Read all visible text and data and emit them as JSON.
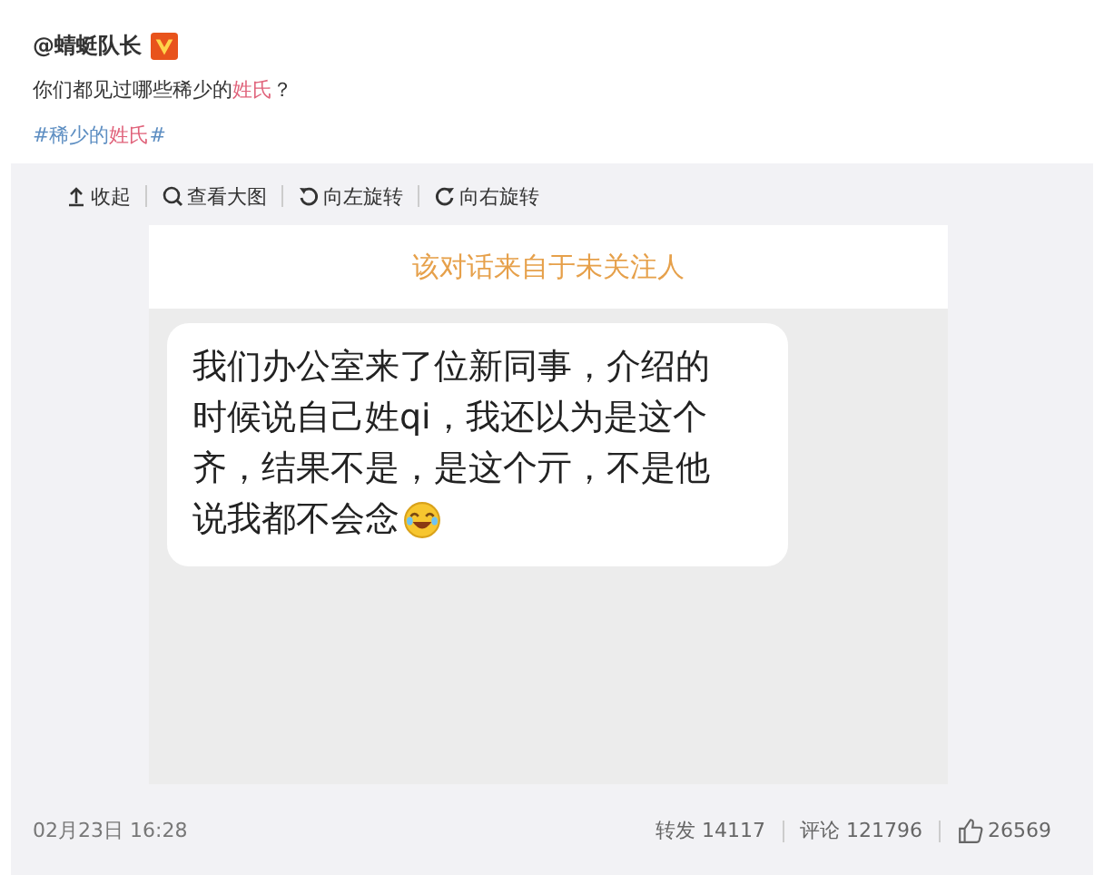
{
  "post": {
    "author": "@蜻蜓队长",
    "verified": true,
    "text_parts": [
      {
        "text": "你们都见过哪些稀少的",
        "highlight": false
      },
      {
        "text": "姓氏",
        "highlight": true
      },
      {
        "text": "？",
        "highlight": false
      }
    ],
    "hashtag_parts": [
      {
        "text": "#稀少的",
        "highlight": false
      },
      {
        "text": "姓氏",
        "highlight": true
      },
      {
        "text": "#",
        "highlight": false
      }
    ]
  },
  "toolbar": [
    {
      "kind": "collapse",
      "label": "收起"
    },
    {
      "kind": "zoom",
      "label": "查看大图"
    },
    {
      "kind": "rotate-left",
      "label": "向左旋转"
    },
    {
      "kind": "rotate-right",
      "label": "向右旋转"
    }
  ],
  "image": {
    "banner": "该对话来自于未关注人",
    "message_lines": [
      "我们办公室来了位新同事，介绍的",
      "时候说自己姓qi，我还以为是这个",
      "齐，结果不是，是这个亓，不是他",
      "说我都不会念"
    ]
  },
  "footer": {
    "date": "02月23日 16:28",
    "repost": "转发 14117",
    "comments": "评论 121796",
    "likes": "26569"
  }
}
